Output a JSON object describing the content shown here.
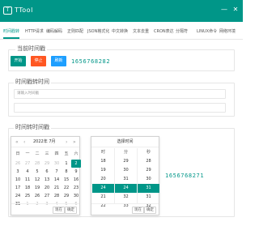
{
  "app": {
    "title": "TTool",
    "logo_glyph": "T"
  },
  "window_controls": {
    "minimize": "—",
    "close": "✕"
  },
  "tabs": [
    {
      "label": "时间戳转"
    },
    {
      "label": "HTTP请求"
    },
    {
      "label": "编码解码"
    },
    {
      "label": "正则匹配"
    },
    {
      "label": "JSON格式化"
    },
    {
      "label": "中文转换"
    },
    {
      "label": "文本去重"
    },
    {
      "label": "CRON表达"
    },
    {
      "label": "分隔符"
    },
    {
      "label": "LINUX命令"
    },
    {
      "label": "网络环境"
    }
  ],
  "current_timestamp": {
    "title": "当前时间戳",
    "start_label": "开始",
    "stop_label": "停止",
    "refresh_label": "刷新",
    "value": "1656768282"
  },
  "ts_to_time": {
    "title": "时间戳转时间",
    "input_placeholder": "请输入时间戳",
    "output_value": ""
  },
  "time_to_ts": {
    "title": "时间转时间戳",
    "date_picker": {
      "header": "2022年 7月",
      "nav_prev_year": "«",
      "nav_prev_month": "‹",
      "nav_next_month": "›",
      "nav_next_year": "»",
      "weekdays": [
        "日",
        "一",
        "二",
        "三",
        "四",
        "五",
        "六"
      ],
      "rows": [
        [
          "26",
          "27",
          "28",
          "29",
          "30",
          "1",
          "2"
        ],
        [
          "3",
          "4",
          "5",
          "6",
          "7",
          "8",
          "9"
        ],
        [
          "10",
          "11",
          "12",
          "13",
          "14",
          "15",
          "16"
        ],
        [
          "17",
          "18",
          "19",
          "20",
          "21",
          "22",
          "23"
        ],
        [
          "24",
          "25",
          "26",
          "27",
          "28",
          "29",
          "30"
        ],
        [
          "31",
          "1",
          "2",
          "3",
          "4",
          "5",
          "6"
        ]
      ],
      "selected_day": "2",
      "clear_label": "现在",
      "confirm_label": "确定"
    },
    "time_picker": {
      "header": "选择时间",
      "columns": [
        "时",
        "分",
        "秒"
      ],
      "hours": [
        "18",
        "19",
        "20",
        "21",
        "22",
        "23"
      ],
      "minutes": [
        "29",
        "30",
        "31",
        "32",
        "33",
        "34"
      ],
      "seconds": [
        "28",
        "29",
        "30",
        "31",
        "32",
        "33"
      ],
      "selected_hour": "24",
      "selected_minute": "24",
      "selected_second": "31",
      "clear_label": "现在",
      "confirm_label": "确定"
    },
    "result": "1656768271"
  },
  "colors": {
    "accent": "#009688",
    "warn": "#ff5722",
    "info": "#1e9fff",
    "dark": "#2f4056"
  }
}
